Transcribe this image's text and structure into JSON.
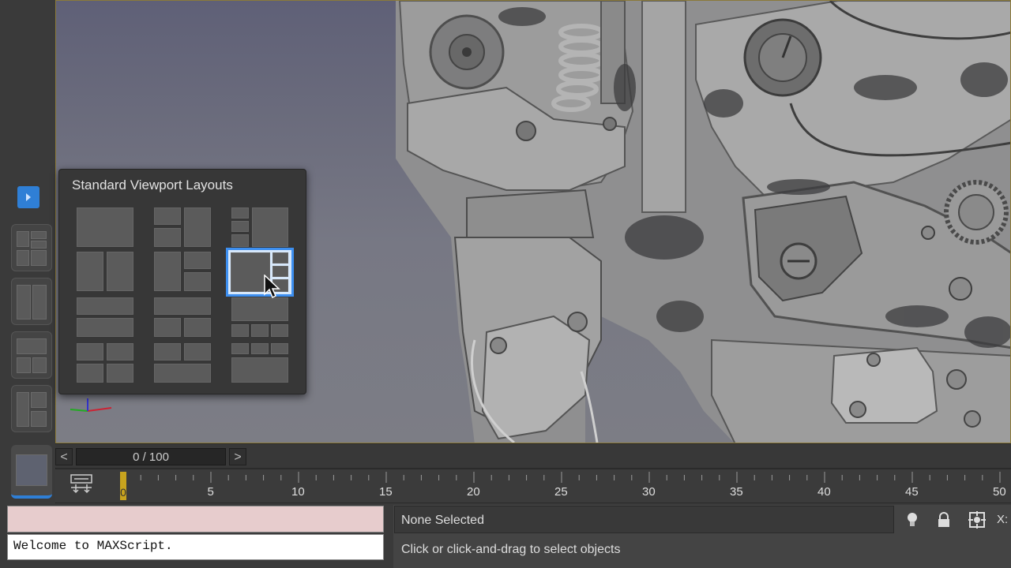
{
  "popup": {
    "title": "Standard Viewport Layouts",
    "selected_index": 5
  },
  "time_slider": {
    "frame_counter": "0 / 100",
    "prev_label": "<",
    "next_label": ">"
  },
  "track_bar": {
    "current_frame": "0",
    "tick_labels": [
      "5",
      "10",
      "15",
      "20",
      "25",
      "30",
      "35",
      "40",
      "45",
      "50"
    ]
  },
  "listener": {
    "output": "Welcome to MAXScript."
  },
  "status": {
    "selection": "None Selected",
    "prompt": "Click or click-and-drag to select objects",
    "coord_label": "X:"
  },
  "icons": [
    "expand-arrow-icon",
    "layout-tab-icon",
    "track-view-icon",
    "light-bulb-icon",
    "lock-icon",
    "selection-crosshair-icon",
    "mouse-cursor-icon",
    "axis-tripod-icon"
  ],
  "colors": {
    "accent": "#3d8ff0",
    "frame_marker": "#c7a31e",
    "listener_input_bg": "#e7cccd"
  }
}
